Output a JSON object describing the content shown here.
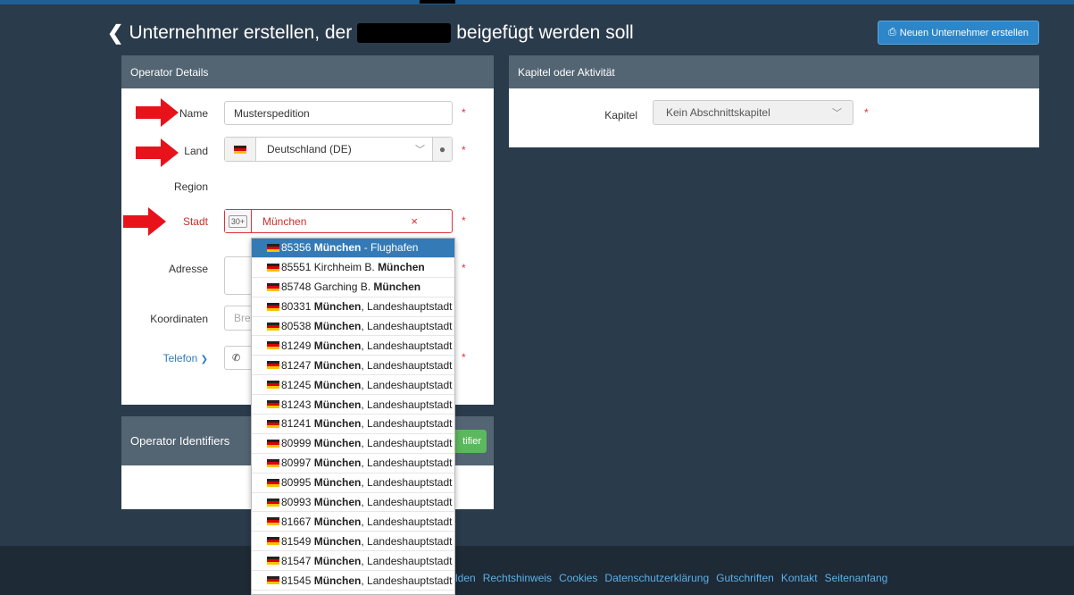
{
  "header": {
    "title_before": "Unternehmer erstellen, der",
    "title_after": "beigefügt werden soll",
    "new_button": "Neuen Unternehmer erstellen"
  },
  "details": {
    "title": "Operator Details",
    "name_label": "Name",
    "name_value": "Musterspedition",
    "land_label": "Land",
    "land_value": "Deutschland (DE)",
    "region_label": "Region",
    "stadt_label": "Stadt",
    "stadt_badge": "30+",
    "stadt_value": "München",
    "adresse_label": "Adresse",
    "koordinaten_label": "Koordinaten",
    "koordinaten_placeholder": "Bre",
    "telefon_label": "Telefon",
    "required": "*"
  },
  "chapter": {
    "title": "Kapitel oder Aktivität",
    "kapitel_label": "Kapitel",
    "kapitel_value": "Kein Abschnittskapitel"
  },
  "identifiers": {
    "title": "Operator Identifiers",
    "button_fragment": "tifier"
  },
  "city_options": [
    {
      "zip": "85356",
      "bold": "München",
      "rest": " - Flughafen",
      "pre": ""
    },
    {
      "zip": "85551",
      "pre": "Kirchheim B. ",
      "bold": "München",
      "rest": ""
    },
    {
      "zip": "85748",
      "pre": "Garching B. ",
      "bold": "München",
      "rest": ""
    },
    {
      "zip": "80331",
      "pre": "",
      "bold": "München",
      "rest": ", Landeshauptstadt"
    },
    {
      "zip": "80538",
      "pre": "",
      "bold": "München",
      "rest": ", Landeshauptstadt"
    },
    {
      "zip": "81249",
      "pre": "",
      "bold": "München",
      "rest": ", Landeshauptstadt"
    },
    {
      "zip": "81247",
      "pre": "",
      "bold": "München",
      "rest": ", Landeshauptstadt"
    },
    {
      "zip": "81245",
      "pre": "",
      "bold": "München",
      "rest": ", Landeshauptstadt"
    },
    {
      "zip": "81243",
      "pre": "",
      "bold": "München",
      "rest": ", Landeshauptstadt"
    },
    {
      "zip": "81241",
      "pre": "",
      "bold": "München",
      "rest": ", Landeshauptstadt"
    },
    {
      "zip": "80999",
      "pre": "",
      "bold": "München",
      "rest": ", Landeshauptstadt"
    },
    {
      "zip": "80997",
      "pre": "",
      "bold": "München",
      "rest": ", Landeshauptstadt"
    },
    {
      "zip": "80995",
      "pre": "",
      "bold": "München",
      "rest": ", Landeshauptstadt"
    },
    {
      "zip": "80993",
      "pre": "",
      "bold": "München",
      "rest": ", Landeshauptstadt"
    },
    {
      "zip": "81667",
      "pre": "",
      "bold": "München",
      "rest": ", Landeshauptstadt"
    },
    {
      "zip": "81549",
      "pre": "",
      "bold": "München",
      "rest": ", Landeshauptstadt"
    },
    {
      "zip": "81547",
      "pre": "",
      "bold": "München",
      "rest": ", Landeshauptstadt"
    },
    {
      "zip": "81545",
      "pre": "",
      "bold": "München",
      "rest": ", Landeshauptstadt"
    }
  ],
  "footer": {
    "links": [
      "lden",
      "Rechtshinweis",
      "Cookies",
      "Datenschutzerklärung",
      "Gutschriften",
      "Kontakt",
      "Seitenanfang"
    ]
  },
  "colors": {
    "background": "#2a3b4b",
    "panel_header": "#536473",
    "accent": "#2d86c8",
    "required": "#e0313b",
    "annotation_arrow": "#e8121b",
    "success": "#5cb85c"
  }
}
